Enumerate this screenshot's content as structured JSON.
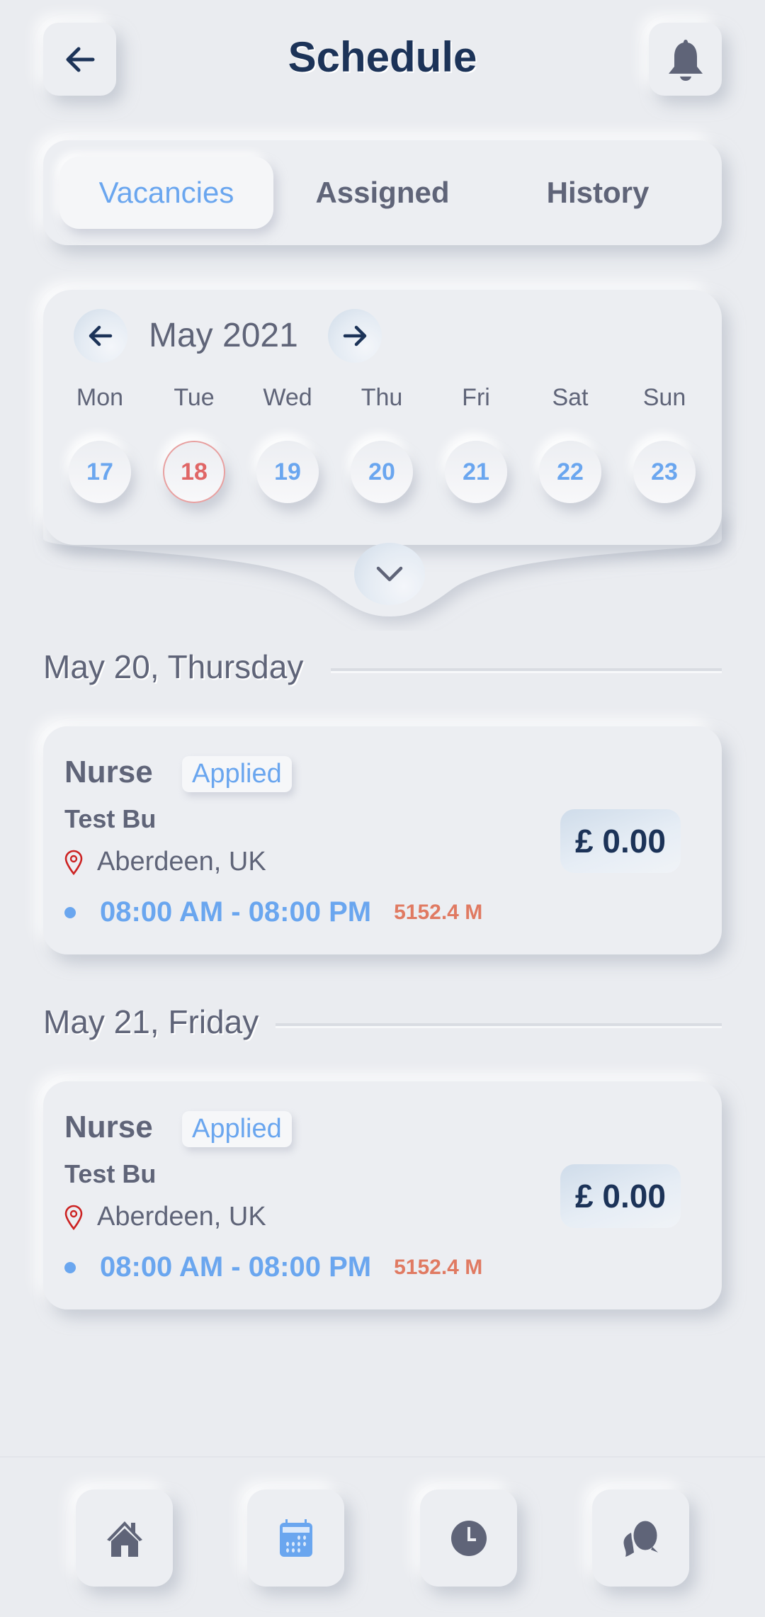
{
  "header": {
    "title": "Schedule",
    "back_icon": "arrow-left-icon",
    "notification_icon": "bell-icon"
  },
  "tabs": [
    {
      "label": "Vacancies",
      "active": true
    },
    {
      "label": "Assigned",
      "active": false
    },
    {
      "label": "History",
      "active": false
    }
  ],
  "calendar": {
    "month_label": "May 2021",
    "prev_icon": "arrow-left-icon",
    "next_icon": "arrow-right-icon",
    "expand_icon": "chevron-down-icon",
    "weekdays": [
      "Mon",
      "Tue",
      "Wed",
      "Thu",
      "Fri",
      "Sat",
      "Sun"
    ],
    "dates": [
      "17",
      "18",
      "19",
      "20",
      "21",
      "22",
      "23"
    ],
    "today": "18"
  },
  "sections": [
    {
      "heading": "May 20, Thursday",
      "job": {
        "role": "Nurse",
        "status": "Applied",
        "company": "Test Bu",
        "location": "Aberdeen, UK",
        "time": "08:00 AM - 08:00 PM",
        "distance": "5152.4 M",
        "price": "£ 0.00"
      }
    },
    {
      "heading": "May 21, Friday",
      "job": {
        "role": "Nurse",
        "status": "Applied",
        "company": "Test Bu",
        "location": "Aberdeen, UK",
        "time": "08:00 AM - 08:00 PM",
        "distance": "5152.4 M",
        "price": "£ 0.00"
      }
    }
  ],
  "bottom_nav": [
    {
      "icon": "home-icon",
      "active": false
    },
    {
      "icon": "calendar-icon",
      "active": true
    },
    {
      "icon": "clock-icon",
      "active": false
    },
    {
      "icon": "chat-icon",
      "active": false
    }
  ],
  "colors": {
    "accent": "#6aa6ef",
    "title": "#1c3358",
    "text": "#5f6478",
    "today": "#e06666",
    "distance": "#e07a62",
    "background": "#eaecf0"
  }
}
